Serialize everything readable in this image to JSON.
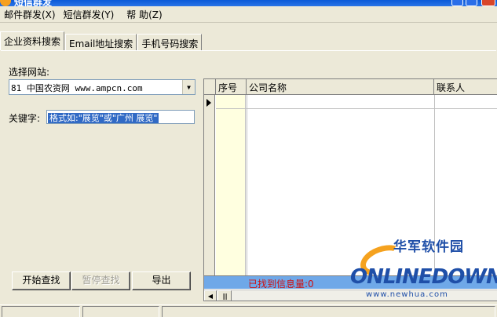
{
  "window": {
    "title_fragment": "短信群发"
  },
  "menu": [
    {
      "label": "邮件群发(X)"
    },
    {
      "label": "短信群发(Y)"
    },
    {
      "label": "帮  助(Z)"
    }
  ],
  "tabs": [
    {
      "label": "企业资料搜索",
      "active": true
    },
    {
      "label": "Email地址搜索",
      "active": false
    },
    {
      "label": "手机号码搜索",
      "active": false
    }
  ],
  "form": {
    "site_label": "选择网站:",
    "site_value": "81 中国农资网 www.ampcn.com",
    "keyword_label": "关键字:",
    "keyword_value": "格式如:\"展览\"或\"广州 展览\""
  },
  "buttons": {
    "start": "开始查找",
    "pause": "暂停查找",
    "export": "导出"
  },
  "grid": {
    "columns": [
      "序号",
      "公司名称",
      "联系人"
    ],
    "status_text": "已找到信息量:0"
  },
  "watermark": {
    "cn_name": "华军软件园",
    "logo": "ONLINEDOWN",
    "url": "www.newhua.com"
  },
  "colors": {
    "selection": "#316ac5",
    "status_row_bg": "#6fa8e8",
    "status_text": "#d01010",
    "seq_column_bg": "#ffffe0",
    "watermark_blue": "#1f4fa8",
    "watermark_orange": "#f5a21f"
  }
}
